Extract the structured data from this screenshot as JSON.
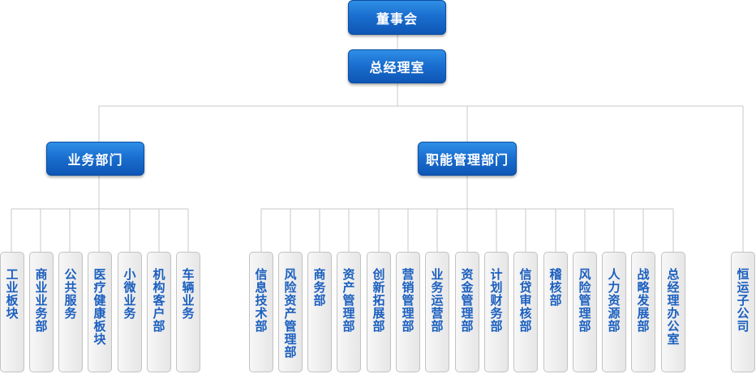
{
  "top": {
    "board": "董事会",
    "gm_office": "总经理室"
  },
  "divisions": {
    "business": "业务部门",
    "functional": "职能管理部门"
  },
  "business_units": [
    "工业板块",
    "商业业务部",
    "公共服务",
    "医疗健康板块",
    "小微业务",
    "机构客户部",
    "车辆业务"
  ],
  "functional_units": [
    "信息技术部",
    "风险资产管理部",
    "商务部",
    "资产管理部",
    "创新拓展部",
    "营销管理部",
    "业务运营部",
    "资金管理部",
    "计划财务部",
    "信贷审核部",
    "稽核部",
    "风险管理部",
    "人力资源部",
    "战略发展部",
    "总经理办公室"
  ],
  "standalone": "恒运子公司",
  "colors": {
    "node_blue": "#1a6fd0",
    "leaf_text": "#1b5fbf",
    "leaf_bg": "#eeeeee",
    "connector": "#c8c8c8"
  }
}
